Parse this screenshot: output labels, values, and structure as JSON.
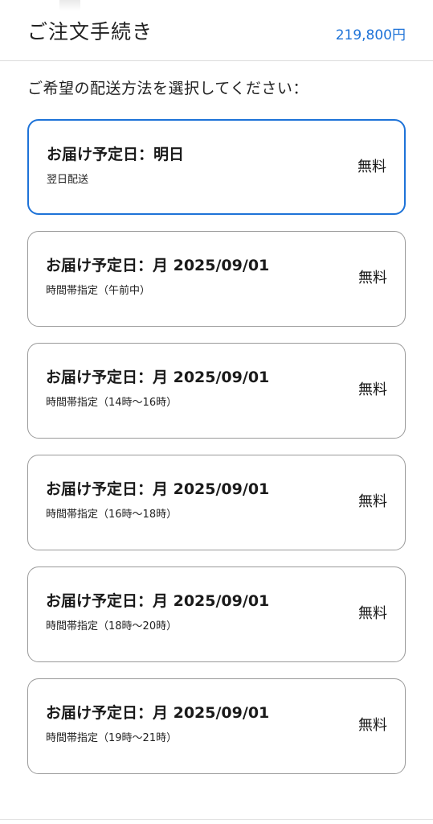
{
  "header": {
    "title": "ご注文手続き",
    "total": "219,800円"
  },
  "prompt": "ご希望の配送方法を選択してください：",
  "options": [
    {
      "title": "お届け予定日：明日",
      "subtitle": "翌日配送",
      "price": "無料",
      "selected": true
    },
    {
      "title": "お届け予定日：月 2025/09/01",
      "subtitle": "時間帯指定（午前中）",
      "price": "無料",
      "selected": false
    },
    {
      "title": "お届け予定日：月 2025/09/01",
      "subtitle": "時間帯指定（14時〜16時）",
      "price": "無料",
      "selected": false
    },
    {
      "title": "お届け予定日：月 2025/09/01",
      "subtitle": "時間帯指定（16時〜18時）",
      "price": "無料",
      "selected": false
    },
    {
      "title": "お届け予定日：月 2025/09/01",
      "subtitle": "時間帯指定（18時〜20時）",
      "price": "無料",
      "selected": false
    },
    {
      "title": "お届け予定日：月 2025/09/01",
      "subtitle": "時間帯指定（19時〜21時）",
      "price": "無料",
      "selected": false
    }
  ],
  "colors": {
    "accent": "#1e73d8",
    "border": "#9a9a9a"
  }
}
